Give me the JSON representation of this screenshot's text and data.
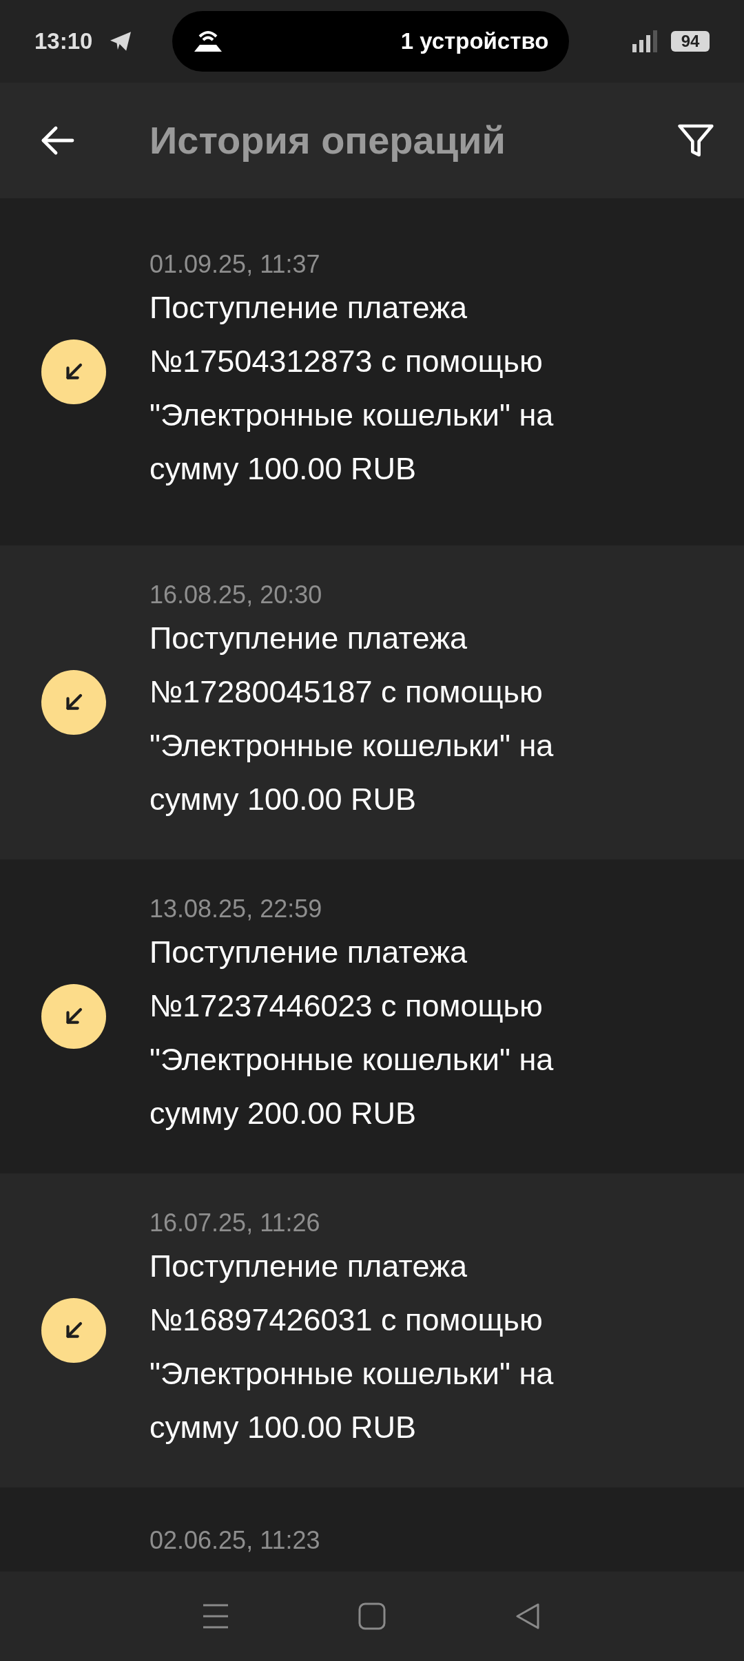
{
  "status_bar": {
    "time": "13:10",
    "hotspot": "1 устройство",
    "battery": "94"
  },
  "header": {
    "title": "История операций"
  },
  "operations": [
    {
      "date": "01.09.25, 11:37",
      "text": "Поступление платежа №17504312873 с помощью \"Электронные кошельки\" на сумму 100.00 RUB",
      "kind": "incoming"
    },
    {
      "date": "16.08.25, 20:30",
      "text": "Поступление платежа №17280045187 с помощью \"Электронные кошельки\" на сумму 100.00 RUB",
      "kind": "incoming"
    },
    {
      "date": "13.08.25, 22:59",
      "text": "Поступление платежа №17237446023 с помощью \"Электронные кошельки\" на сумму 200.00 RUB",
      "kind": "incoming"
    },
    {
      "date": "16.07.25, 11:26",
      "text": "Поступление платежа №16897426031 с помощью \"Электронные кошельки\" на сумму 100.00 RUB",
      "kind": "incoming"
    },
    {
      "date": "02.06.25, 11:23"
    }
  ]
}
